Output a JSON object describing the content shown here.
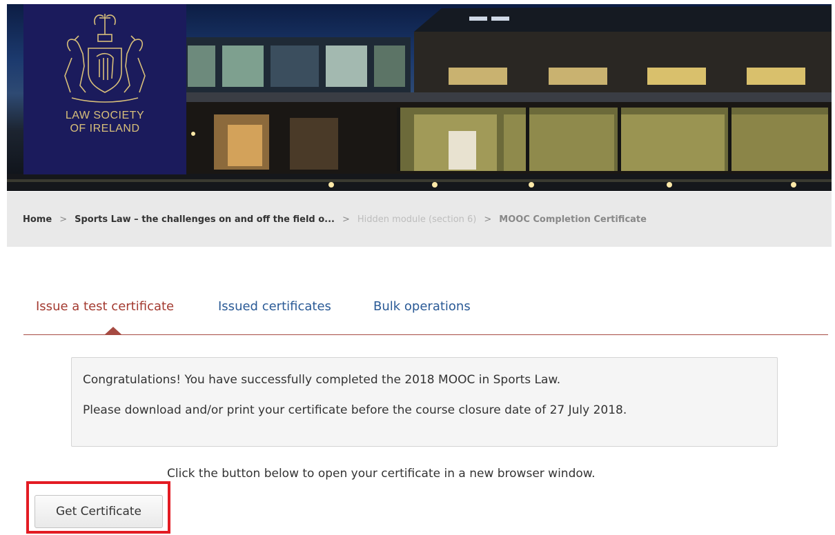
{
  "header": {
    "logo": {
      "line1": "LAW SOCIETY",
      "line2": "OF IRELAND",
      "color": "#d9c07a",
      "background": "#1b1b5c"
    }
  },
  "breadcrumb": {
    "separator": ">",
    "items": [
      {
        "label": "Home"
      },
      {
        "label": "Sports Law – the challenges on and off the field o..."
      },
      {
        "label": "Hidden module (section 6)"
      },
      {
        "label": "MOOC Completion Certificate"
      }
    ]
  },
  "tabs": [
    {
      "label": "Issue a test certificate",
      "active": true
    },
    {
      "label": "Issued certificates",
      "active": false
    },
    {
      "label": "Bulk operations",
      "active": false
    }
  ],
  "notice": {
    "line1": "Congratulations! You have successfully completed the 2018 MOOC in Sports Law.",
    "line2": "Please download and/or print your certificate before the course closure date of 27 July 2018."
  },
  "instruction": "Click the button below to open your certificate in a new browser window.",
  "button": {
    "label": "Get Certificate"
  },
  "colors": {
    "active_tab": "#a33a30",
    "link_tab": "#2a5a96",
    "highlight": "#e31b23",
    "breadcrumb_bg": "#e9e9e9"
  }
}
